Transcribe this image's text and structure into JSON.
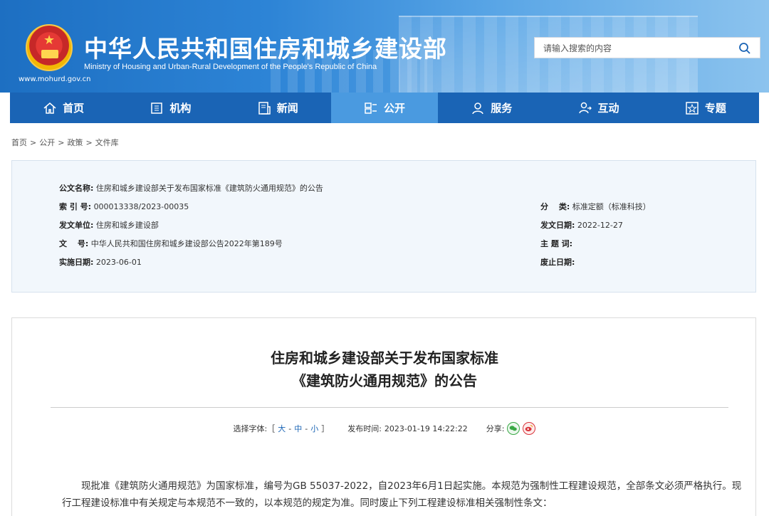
{
  "header": {
    "site_title": "中华人民共和国住房和城乡建设部",
    "site_subtitle": "Ministry of Housing and Urban-Rural Development of the People's Republic of China",
    "site_url": "www.mohurd.gov.cn",
    "search_placeholder": "请输入搜索的内容"
  },
  "nav": {
    "items": [
      {
        "label": "首页",
        "icon": "home-icon"
      },
      {
        "label": "机构",
        "icon": "building-icon"
      },
      {
        "label": "新闻",
        "icon": "news-icon"
      },
      {
        "label": "公开",
        "icon": "public-icon",
        "active": true
      },
      {
        "label": "服务",
        "icon": "service-icon"
      },
      {
        "label": "互动",
        "icon": "interaction-icon"
      },
      {
        "label": "专题",
        "icon": "topic-icon"
      }
    ]
  },
  "breadcrumb": [
    "首页",
    "公开",
    "政策",
    "文件库"
  ],
  "info": {
    "doc_name_label": "公文名称:",
    "doc_name": "住房和城乡建设部关于发布国家标准《建筑防火通用规范》的公告",
    "index_label": "索 引 号:",
    "index_value": "000013338/2023-00035",
    "category_label": "分　 类:",
    "category_value": "标准定额（标准科技）",
    "issuer_label": "发文单位:",
    "issuer_value": "住房和城乡建设部",
    "issue_date_label": "发文日期:",
    "issue_date_value": "2022-12-27",
    "doc_no_label": "文　 号:",
    "doc_no_value": "中华人民共和国住房和城乡建设部公告2022年第189号",
    "subject_label": "主 题 词:",
    "subject_value": "",
    "effective_label": "实施日期:",
    "effective_value": "2023-06-01",
    "repeal_label": "废止日期:",
    "repeal_value": ""
  },
  "article": {
    "title_line1": "住房和城乡建设部关于发布国家标准",
    "title_line2": "《建筑防火通用规范》的公告",
    "font_select_label": "选择字体:［",
    "font_large": "大",
    "font_medium": "中",
    "font_small": "小",
    "font_close": "］",
    "font_sep": "-",
    "publish_label": "发布时间:",
    "publish_time": "2023-01-19 14:22:22",
    "share_label": "分享:",
    "body": "现批准《建筑防火通用规范》为国家标准，编号为GB 55037-2022，自2023年6月1日起实施。本规范为强制性工程建设规范，全部条文必须严格执行。现行工程建设标准中有关规定与本规范不一致的，以本规范的规定为准。同时废止下列工程建设标准相关强制性条文："
  },
  "colors": {
    "nav_bg": "#1a64b5",
    "nav_active": "#4a9ae0",
    "info_bg": "#f2f7fc",
    "link": "#1a64b5"
  }
}
